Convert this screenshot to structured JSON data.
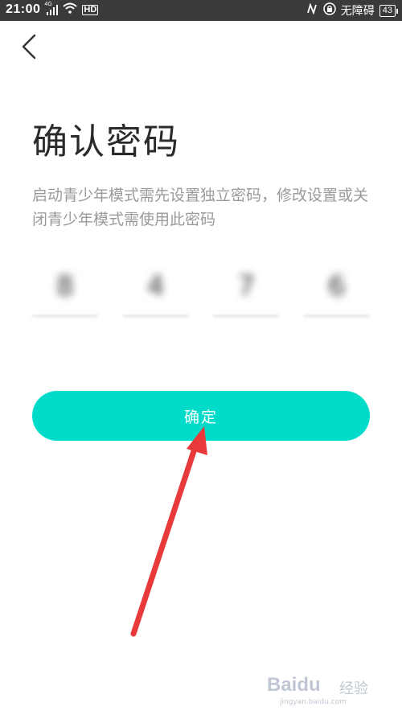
{
  "status_bar": {
    "time": "21:00",
    "network": "4G",
    "hd": "HD",
    "accessibility": "无障碍",
    "battery": "43"
  },
  "icons": {
    "back": "chevron-left-icon",
    "signal": "signal-icon",
    "wifi": "wifi-icon",
    "nfc": "nfc-icon",
    "lock": "lock-icon"
  },
  "page": {
    "title": "确认密码",
    "description": "启动青少年模式需先设置独立密码，修改设置或关闭青少年模式需使用此密码"
  },
  "pin": {
    "digits": [
      "8",
      "4",
      "7",
      "6"
    ]
  },
  "actions": {
    "confirm_label": "确定"
  },
  "watermark": {
    "brand": "Baidu",
    "brand_cn": "经验",
    "site": "jingyan.baidu.com"
  },
  "colors": {
    "accent": "#00dcc9",
    "annotation_arrow": "#e8393b",
    "status_bar_bg": "#3a3a3a"
  }
}
